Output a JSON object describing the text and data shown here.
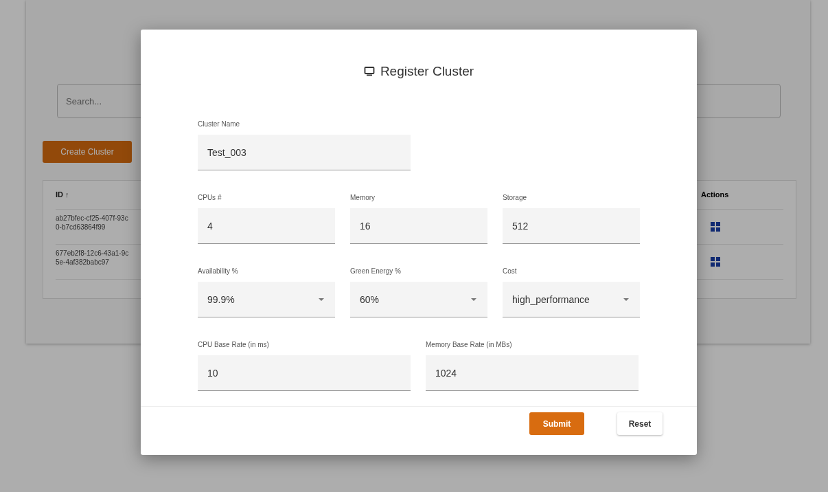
{
  "background": {
    "search": {
      "placeholder": "Search..."
    },
    "create_button": "Create Cluster",
    "table": {
      "columns": [
        {
          "label": "ID ↑"
        },
        {
          "label": "Actions"
        }
      ],
      "rows": [
        {
          "id": "ab27bfec-cf25-407f-93c0-b7cd63864f99"
        },
        {
          "id": "677eb2f8-12c6-43a1-9c5e-4af382babc97"
        }
      ]
    }
  },
  "dialog": {
    "title": "Register Cluster",
    "rows": [
      [
        {
          "label": "Cluster Name",
          "value": "Test_003",
          "kind": "text"
        }
      ],
      [
        {
          "label": "CPUs #",
          "value": "4",
          "kind": "text"
        },
        {
          "label": "Memory",
          "value": "16",
          "kind": "text"
        },
        {
          "label": "Storage",
          "value": "512",
          "kind": "text"
        }
      ],
      [
        {
          "label": "Availability %",
          "value": "99.9%",
          "kind": "select"
        },
        {
          "label": "Green Energy %",
          "value": "60%",
          "kind": "select"
        },
        {
          "label": "Cost",
          "value": "high_performance",
          "kind": "select"
        }
      ],
      [
        {
          "label": "CPU Base Rate (in ms)",
          "value": "10",
          "kind": "text"
        },
        {
          "label": "Memory Base Rate (in MBs)",
          "value": "1024",
          "kind": "text"
        }
      ]
    ],
    "buttons": [
      {
        "label": "Submit",
        "kind": "primary"
      },
      {
        "label": "Reset",
        "kind": "secondary"
      }
    ]
  }
}
